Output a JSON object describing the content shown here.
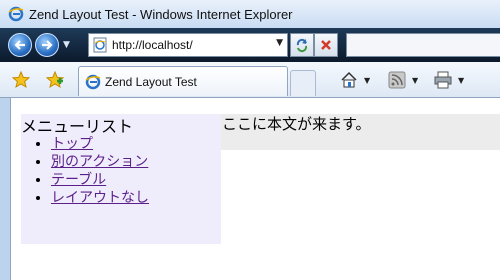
{
  "window": {
    "title": "Zend Layout Test - Windows Internet Explorer"
  },
  "nav": {
    "address": "http://localhost/",
    "icons": [
      "back-icon",
      "forward-icon",
      "refresh-icon",
      "stop-icon"
    ]
  },
  "tabs": {
    "active_label": "Zend Layout Test"
  },
  "command_bar": {
    "items": [
      "home-icon",
      "feeds-icon",
      "print-icon"
    ]
  },
  "page": {
    "sidebar_title": "メニューリスト",
    "menu_items": [
      "トップ",
      "別のアクション",
      "テーブル",
      "レイアウトなし"
    ],
    "main_text": "ここに本文が来ます。"
  },
  "colors": {
    "sidebar_bg": "#efedfc",
    "visited_link": "#5b1f8a",
    "main_strip_bg": "#ececec"
  }
}
